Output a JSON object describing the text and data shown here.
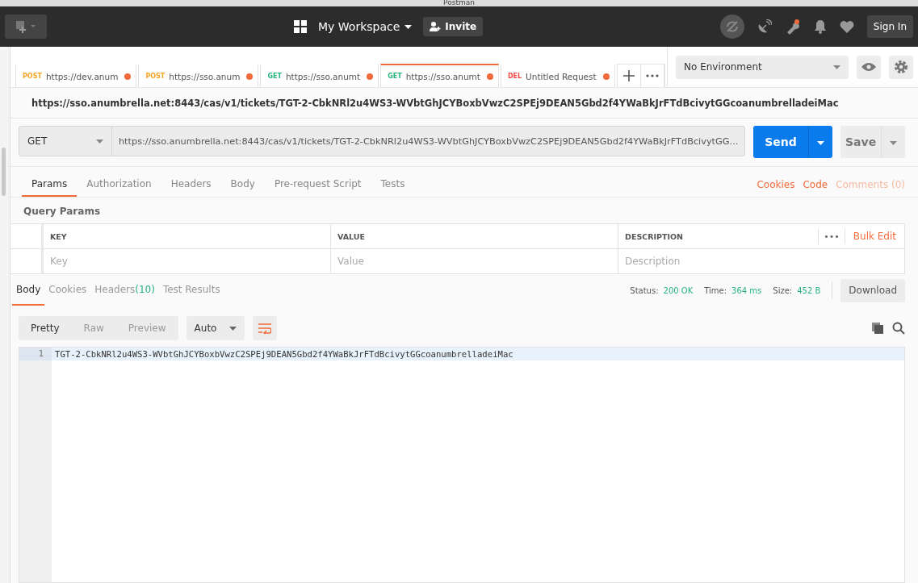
{
  "window": {
    "title": "Postman"
  },
  "header": {
    "workspace": "My Workspace",
    "invite": "Invite",
    "sign_in": "Sign In"
  },
  "tabs": [
    {
      "method": "POST",
      "color": "#f5a623",
      "url": "https://dev.anum",
      "modified": true,
      "selected": false
    },
    {
      "method": "POST",
      "color": "#f5a623",
      "url": "https://sso.anum",
      "modified": true,
      "selected": false
    },
    {
      "method": "GET",
      "color": "#26b47f",
      "url": "https://sso.anumt",
      "modified": true,
      "selected": false
    },
    {
      "method": "GET",
      "color": "#26b47f",
      "url": "https://sso.anumt",
      "modified": true,
      "selected": true
    },
    {
      "method": "DEL",
      "color": "#ed4b48",
      "url": "Untitled Request",
      "modified": true,
      "selected": false
    }
  ],
  "environment": {
    "value": "No Environment"
  },
  "request": {
    "title": "https://sso.anumbrella.net:8443/cas/v1/tickets/TGT-2-CbkNRl2u4WS3-WVbtGhJCYBoxbVwzC2SPEj9DEAN5Gbd2f4YWaBkJrFTdBcivytGGcoanumbrelladeiMac",
    "method": "GET",
    "url": "https://sso.anumbrella.net:8443/cas/v1/tickets/TGT-2-CbkNRl2u4WS3-WVbtGhJCYBoxbVwzC2SPEj9DEAN5Gbd2f4YWaBkJrFTdBcivytGG...",
    "send": "Send",
    "save": "Save"
  },
  "request_tabs": [
    {
      "label": "Params",
      "selected": true
    },
    {
      "label": "Authorization",
      "selected": false
    },
    {
      "label": "Headers",
      "selected": false
    },
    {
      "label": "Body",
      "selected": false
    },
    {
      "label": "Pre-request Script",
      "selected": false
    },
    {
      "label": "Tests",
      "selected": false
    }
  ],
  "request_links": [
    {
      "label": "Cookies",
      "disabled": false
    },
    {
      "label": "Code",
      "disabled": false
    },
    {
      "label": "Comments (0)",
      "disabled": true
    }
  ],
  "query_params": {
    "title": "Query Params",
    "columns": [
      "KEY",
      "VALUE",
      "DESCRIPTION"
    ],
    "more": "•••",
    "bulk_edit": "Bulk Edit",
    "placeholders": [
      "Key",
      "Value",
      "Description"
    ]
  },
  "response_tabs": [
    {
      "label": "Body",
      "selected": true
    },
    {
      "label": "Cookies",
      "selected": false
    },
    {
      "label": "Headers",
      "count": "(10)",
      "selected": false
    },
    {
      "label": "Test Results",
      "selected": false
    }
  ],
  "status": [
    {
      "label": "Status:",
      "value": "200 OK"
    },
    {
      "label": "Time:",
      "value": "364 ms"
    },
    {
      "label": "Size:",
      "value": "452 B"
    }
  ],
  "download": "Download",
  "formats": [
    {
      "label": "Pretty",
      "selected": true
    },
    {
      "label": "Raw",
      "selected": false
    },
    {
      "label": "Preview",
      "selected": false
    }
  ],
  "language": "Auto",
  "body_lines": [
    {
      "number": "1",
      "text": "TGT-2-CbkNRl2u4WS3-WVbtGhJCYBoxbVwzC2SPEj9DEAN5Gbd2f4YWaBkJrFTdBcivytGGcoanumbrelladeiMac"
    }
  ]
}
